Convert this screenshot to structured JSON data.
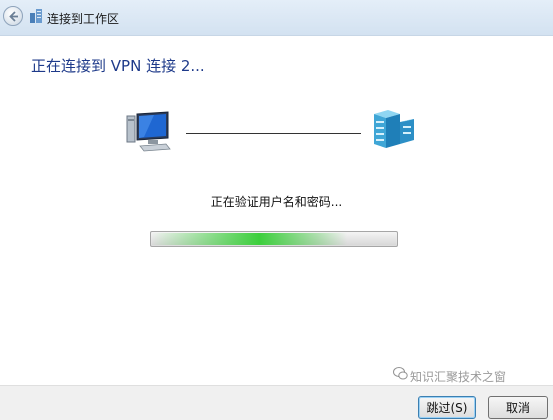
{
  "window": {
    "title": "连接到工作区"
  },
  "main": {
    "heading": "正在连接到 VPN 连接 2...",
    "status": "正在验证用户名和密码...",
    "progress_fraction": 0.8
  },
  "footer": {
    "skip_label": "跳过(S)",
    "cancel_label": "取消"
  },
  "watermark": {
    "text": "知识汇聚技术之窗"
  },
  "colors": {
    "heading": "#1e3a8a",
    "progress_green": "#3ccf3c"
  },
  "icons": {
    "back": "back-arrow-icon",
    "title": "network-icon",
    "computer": "computer-icon",
    "server": "server-icon"
  }
}
